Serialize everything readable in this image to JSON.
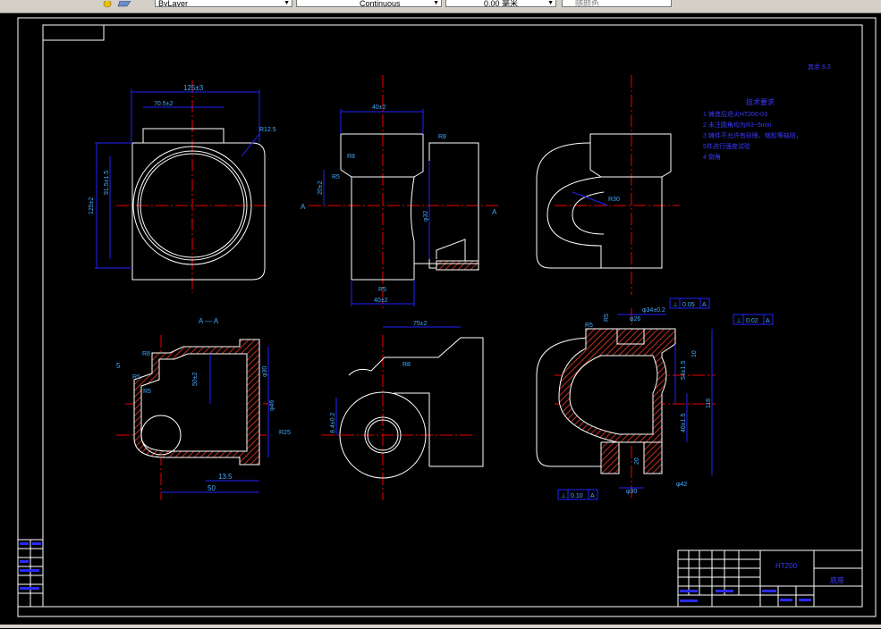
{
  "toolbar": {
    "layer_value": "ByLayer",
    "linetype_value": "Continuous",
    "lineweight_value": "0.00 毫米",
    "plotstyle_value": "随颜色"
  },
  "drawing": {
    "top_view": {
      "dim_overall_width": "125±3",
      "dim_flange_width": "70.5±2",
      "dim_height": "125±2",
      "dim_inner_height": "91.5±1.5",
      "dim_radius": "R12.5"
    },
    "front_view": {
      "dim_top": "40±2",
      "dim_bottom": "40±2",
      "dim_r_top": "R8",
      "dim_r_left": "R5",
      "dim_r_lower": "R5",
      "dim_r_right": "R8",
      "dim_left_vertical": "20±2",
      "dim_vertical": "86±2",
      "dim_diameter": "φ32",
      "section_mark_left": "A",
      "section_mark_right": "A"
    },
    "side_view": {
      "dim_radius": "R30"
    },
    "technical_requirements": {
      "title": "技术要求",
      "items": [
        "1  铸造后退火HT200-03",
        "2  未注圆角均为R3~5mm",
        "3  铸件不允许有砂眼、缩松等缺陷，",
        "   5件进行强度试验",
        "4  倒角"
      ]
    },
    "roughness_other": "其余 6.3",
    "section_view": {
      "title": "A — A",
      "dim_r_top": "R8",
      "dim_r_mid": "R5",
      "dim_r_inner": "R5",
      "dim_left": "5",
      "dim_right_vertical": "50±2",
      "dim_phi_right": "φ30",
      "dim_height": "φ46",
      "dim_bottom_1": "13.5",
      "dim_bottom_2": "50",
      "dim_angle": "R25"
    },
    "bottom_mid_view": {
      "dim_top": "75±2",
      "dim_radius": "R8",
      "dim_left": "8.4±0.2"
    },
    "bottom_right_view": {
      "tolerance_1": "0.05",
      "tolerance_1_datum": "A",
      "tolerance_2": "0.02",
      "tolerance_2_datum": "A",
      "tolerance_3": "0.10",
      "tolerance_3_datum": "A",
      "dim_top": "φ34±0.2",
      "dim_inner": "φ26",
      "dim_vertical_1": "54±1.5",
      "dim_vertical_2": "40±1.5",
      "dim_height": "116",
      "dim_right": "10",
      "dim_bottom": "φ30",
      "dim_bottom_small": "φ42",
      "dim_small_left": "R5",
      "dim_r_left": "R5",
      "dim_left_vert": "20"
    },
    "title_block": {
      "material": "HT200",
      "part_name": "底座"
    }
  },
  "colors": {
    "line": "#ffffff",
    "dimension": "#0000ff",
    "center": "#ff0000",
    "hatch": "#b22222",
    "text_blue": "#3a3aff"
  }
}
